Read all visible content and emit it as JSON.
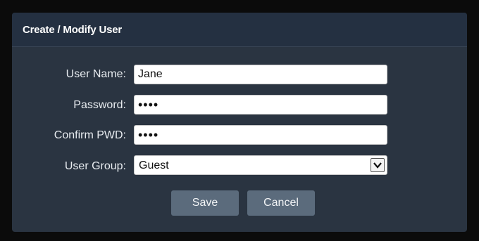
{
  "dialog": {
    "title": "Create / Modify User"
  },
  "form": {
    "user_name": {
      "label": "User Name:",
      "value": "Jane"
    },
    "password": {
      "label": "Password:",
      "value": "••••"
    },
    "confirm_password": {
      "label": "Confirm PWD:",
      "value": "••••"
    },
    "user_group": {
      "label": "User Group:",
      "selected": "Guest"
    }
  },
  "buttons": {
    "save_label": "Save",
    "cancel_label": "Cancel"
  },
  "icons": {
    "dropdown": "chevron-down-icon"
  },
  "colors": {
    "page_background": "#0b0b0b",
    "dialog_background": "#2a3441",
    "header_background": "#243041",
    "button_background": "#5b6b7c"
  }
}
